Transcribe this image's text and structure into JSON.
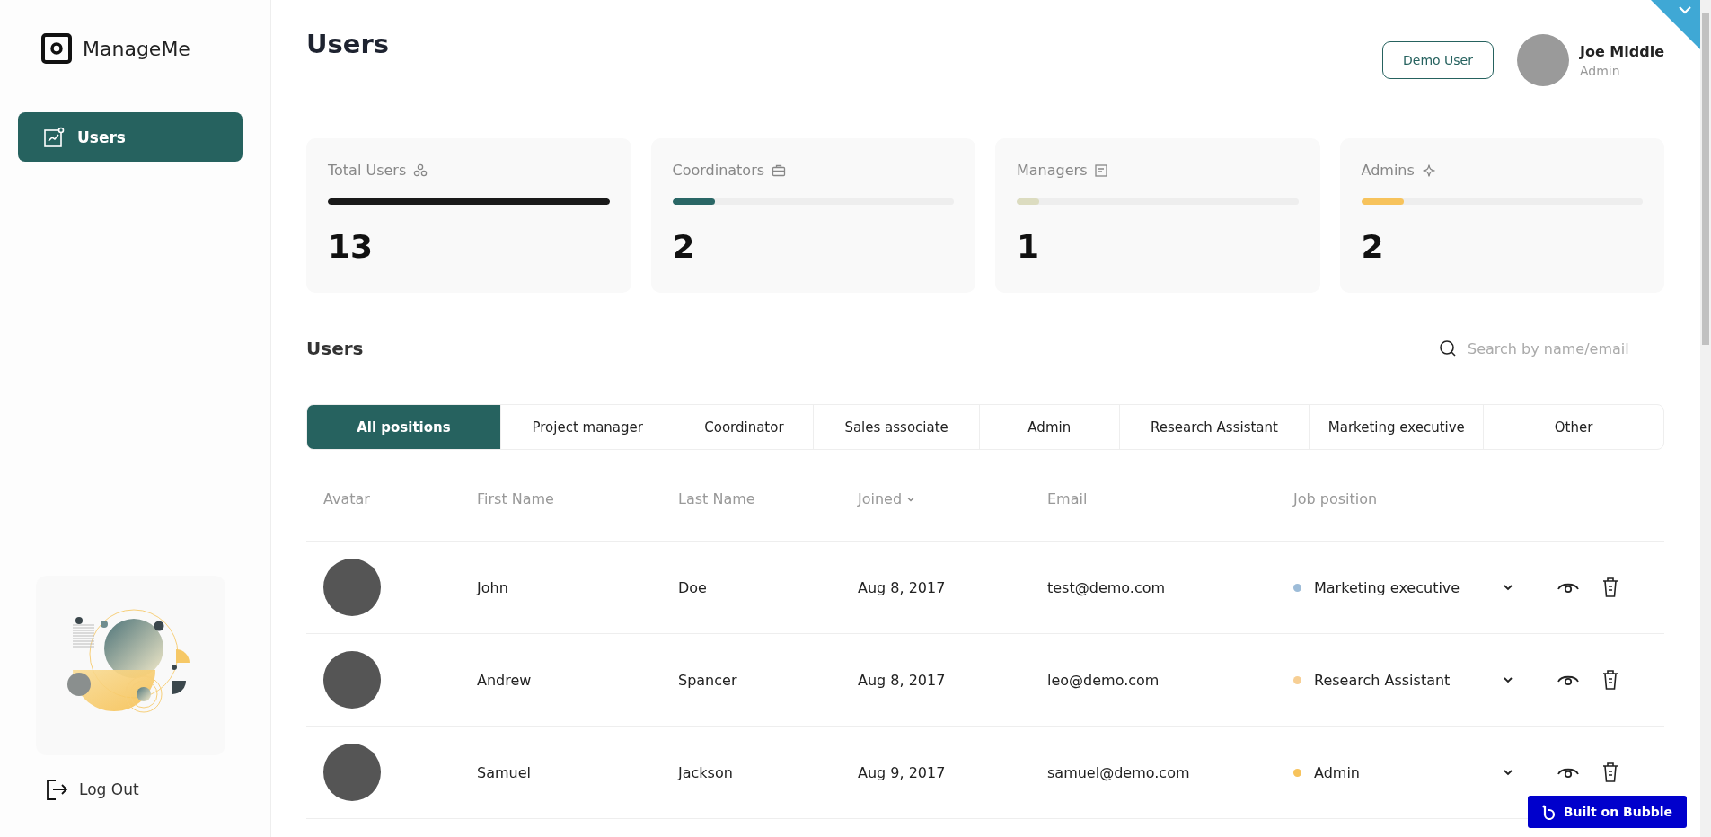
{
  "sidebar": {
    "logo": "ManageMe",
    "nav": [
      {
        "label": "Users",
        "selected": true
      }
    ],
    "logout": "Log Out"
  },
  "header": {
    "title": "Users",
    "demo_button": "Demo User",
    "user": {
      "name": "Joe Middle",
      "role": "Admin"
    }
  },
  "stats": [
    {
      "label": "Total Users",
      "value": "13",
      "level": 1,
      "color": "#1a1a1a"
    },
    {
      "label": "Coordinators",
      "value": "2",
      "level": 0.15,
      "color": "#2a6766"
    },
    {
      "label": "Managers",
      "value": "1",
      "level": 0.08,
      "color": "#dcdcc0"
    },
    {
      "label": "Admins",
      "value": "2",
      "level": 0.15,
      "color": "#f7c35c"
    }
  ],
  "users_section": {
    "title": "Users",
    "search": {
      "placeholder": "Search by name/email"
    },
    "tabs": [
      {
        "label": "All positions",
        "selected": true
      },
      {
        "label": "Project manager",
        "selected": false
      },
      {
        "label": "Coordinator",
        "selected": false
      },
      {
        "label": "Sales associate",
        "selected": false
      },
      {
        "label": "Admin",
        "selected": false
      },
      {
        "label": "Research Assistant",
        "selected": false
      },
      {
        "label": "Marketing executive",
        "selected": false
      },
      {
        "label": "Other",
        "selected": false
      }
    ],
    "table": {
      "columns": [
        {
          "label": "Avatar",
          "sorted": false
        },
        {
          "label": "First Name",
          "sorted": false
        },
        {
          "label": "Last Name",
          "sorted": false
        },
        {
          "label": "Joined",
          "sorted": true
        },
        {
          "label": "Email",
          "sorted": false
        },
        {
          "label": "Job position",
          "sorted": false
        }
      ],
      "rows": [
        {
          "first_name": "John",
          "last_name": "Doe",
          "joined": "Aug 8, 2017",
          "email": "test@demo.com",
          "position": "Marketing executive",
          "color": "#9dbcd8"
        },
        {
          "first_name": "Andrew",
          "last_name": "Spancer",
          "joined": "Aug 8, 2017",
          "email": "leo@demo.com",
          "position": "Research Assistant",
          "color": "#f7cf94"
        },
        {
          "first_name": "Samuel",
          "last_name": "Jackson",
          "joined": "Aug 9, 2017",
          "email": "samuel@demo.com",
          "position": "Admin",
          "color": "#f7c35c"
        }
      ]
    }
  },
  "badge": "Built on Bubble"
}
